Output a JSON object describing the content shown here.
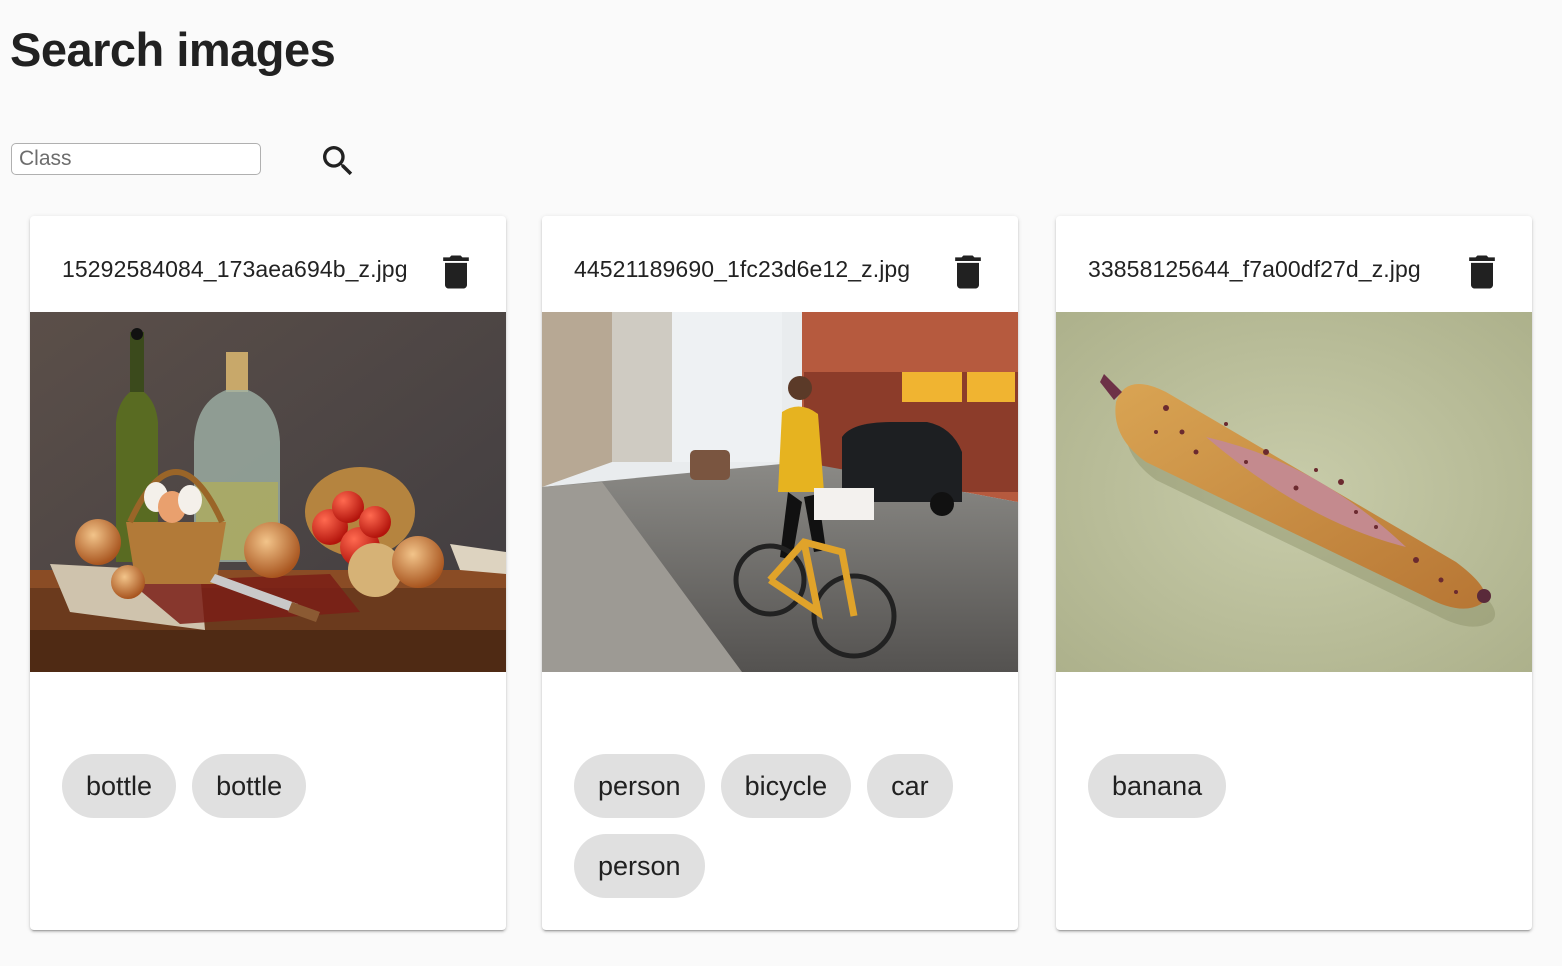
{
  "page": {
    "title": "Search images"
  },
  "search": {
    "placeholder": "Class",
    "value": "",
    "button_icon": "search-icon"
  },
  "cards": [
    {
      "filename": "15292584084_173aea694b_z.jpg",
      "delete_icon": "trash-icon",
      "image_subject": "still life with bottles, onions, eggs in basket and tomatoes",
      "tags": [
        "bottle",
        "bottle"
      ]
    },
    {
      "filename": "44521189690_1fc23d6e12_z.jpg",
      "delete_icon": "trash-icon",
      "image_subject": "woman riding yellow bicycle on cobblestone street with cars",
      "tags": [
        "person",
        "bicycle",
        "car",
        "person"
      ]
    },
    {
      "filename": "33858125644_f7a00df27d_z.jpg",
      "delete_icon": "trash-icon",
      "image_subject": "spotted banana with slit peel on green cloth",
      "tags": [
        "banana"
      ]
    }
  ],
  "colors": {
    "background": "#fafafa",
    "card": "#ffffff",
    "chip": "#e0e0e0",
    "icon": "#212121"
  }
}
